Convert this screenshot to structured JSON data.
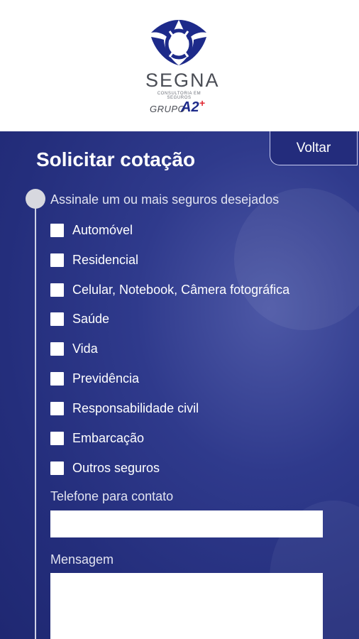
{
  "brand": {
    "name": "SEGNA",
    "subtitle": "CONSULTORIA EM SEGUROS",
    "group_prefix": "GRUPO",
    "group_mark": "A2",
    "group_plus": "+",
    "colors": {
      "navy": "#1d2a8a",
      "red": "#e0262f",
      "gray": "#4a4d55"
    }
  },
  "header": {
    "title": "Solicitar cotação",
    "back_label": "Voltar"
  },
  "insurance_section": {
    "label": "Assinale um ou mais seguros desejados",
    "options": [
      {
        "label": "Automóvel",
        "checked": false
      },
      {
        "label": "Residencial",
        "checked": false
      },
      {
        "label": "Celular, Notebook, Câmera fotográfica",
        "checked": false
      },
      {
        "label": "Saúde",
        "checked": false
      },
      {
        "label": "Vida",
        "checked": false
      },
      {
        "label": "Previdência",
        "checked": false
      },
      {
        "label": "Responsabilidade civil",
        "checked": false
      },
      {
        "label": "Embarcação",
        "checked": false
      },
      {
        "label": "Outros seguros",
        "checked": false
      }
    ]
  },
  "phone": {
    "label": "Telefone para contato",
    "value": ""
  },
  "message": {
    "label": "Mensagem",
    "value": ""
  },
  "theme": {
    "background": "#2a3484",
    "text": "#ffffff"
  }
}
